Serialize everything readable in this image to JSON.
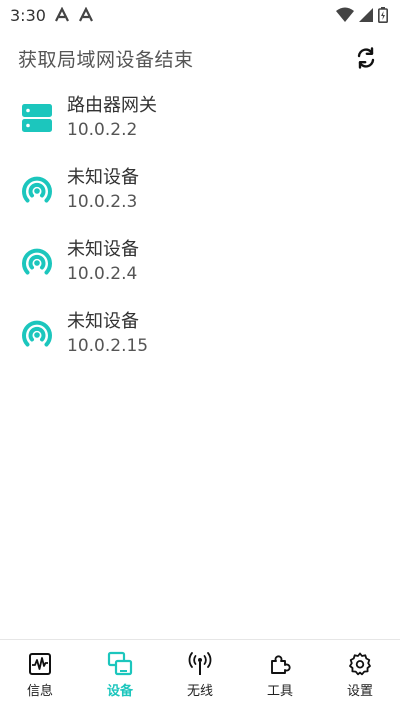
{
  "status_bar": {
    "time": "3:30"
  },
  "header": {
    "title": "获取局域网设备结束"
  },
  "colors": {
    "accent": "#1cc6bd",
    "text": "#333333",
    "muted": "#555555"
  },
  "devices": [
    {
      "name": "路由器网关",
      "ip": "10.0.2.2",
      "icon": "router-icon"
    },
    {
      "name": "未知设备",
      "ip": "10.0.2.3",
      "icon": "broadcast-icon"
    },
    {
      "name": "未知设备",
      "ip": "10.0.2.4",
      "icon": "broadcast-icon"
    },
    {
      "name": "未知设备",
      "ip": "10.0.2.15",
      "icon": "broadcast-icon"
    }
  ],
  "nav": [
    {
      "label": "信息",
      "icon": "pulse-icon",
      "active": false
    },
    {
      "label": "设备",
      "icon": "devices-icon",
      "active": true
    },
    {
      "label": "无线",
      "icon": "antenna-icon",
      "active": false
    },
    {
      "label": "工具",
      "icon": "puzzle-icon",
      "active": false
    },
    {
      "label": "设置",
      "icon": "gear-icon",
      "active": false
    }
  ]
}
